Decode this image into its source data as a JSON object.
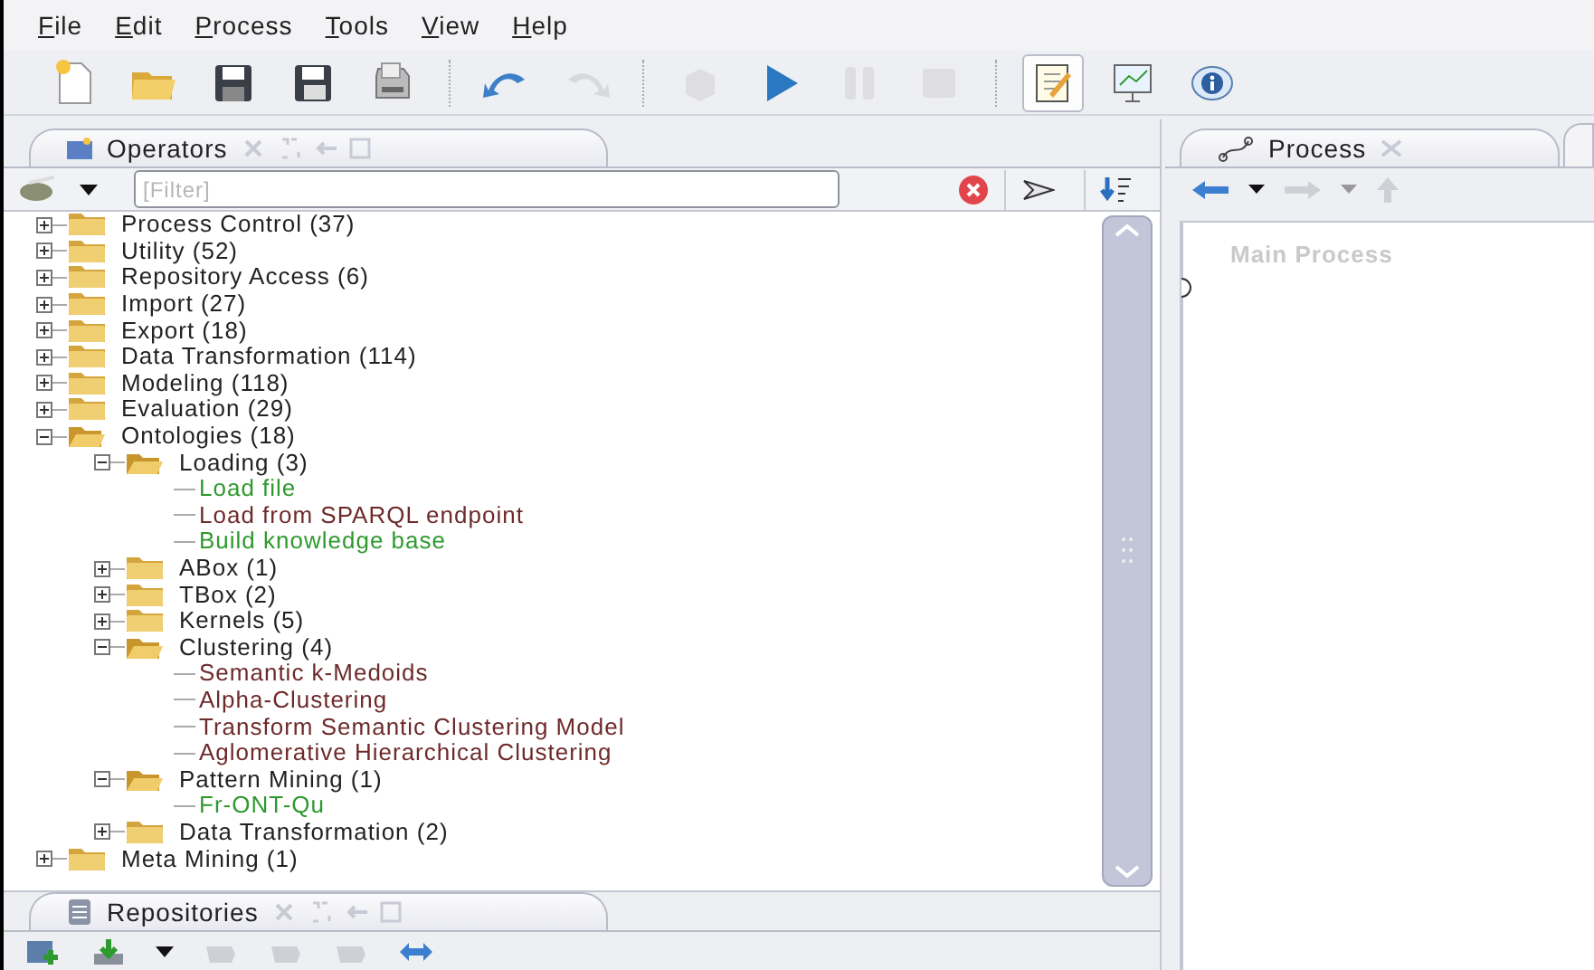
{
  "menu": [
    {
      "label": "File"
    },
    {
      "label": "Edit"
    },
    {
      "label": "Process"
    },
    {
      "label": "Tools"
    },
    {
      "label": "View"
    },
    {
      "label": "Help"
    }
  ],
  "toolbar": [
    [
      {
        "kind": "new",
        "disabled": false
      },
      {
        "kind": "open",
        "disabled": false
      },
      {
        "kind": "save",
        "disabled": false
      },
      {
        "kind": "saveas",
        "disabled": false
      },
      {
        "kind": "print",
        "disabled": false
      }
    ],
    [
      {
        "kind": "undo",
        "disabled": false
      },
      {
        "kind": "redo",
        "disabled": true
      }
    ],
    [
      {
        "kind": "cube",
        "disabled": true
      },
      {
        "kind": "run",
        "disabled": false
      },
      {
        "kind": "pause",
        "disabled": true
      },
      {
        "kind": "stop",
        "disabled": true
      }
    ],
    [
      {
        "kind": "design",
        "disabled": false,
        "selected": true
      },
      {
        "kind": "results",
        "disabled": false,
        "selected": false
      },
      {
        "kind": "info",
        "disabled": false,
        "selected": false
      }
    ]
  ],
  "operators_panel": {
    "tab": "Operators",
    "filter": {
      "placeholder": "[Filter]"
    },
    "tree": [
      {
        "label": "Process Control (37)",
        "expanded": false
      },
      {
        "label": "Utility (52)",
        "expanded": false
      },
      {
        "label": "Repository Access (6)",
        "expanded": false
      },
      {
        "label": "Import (27)",
        "expanded": false
      },
      {
        "label": "Export (18)",
        "expanded": false
      },
      {
        "label": "Data Transformation (114)",
        "expanded": false
      },
      {
        "label": "Modeling (118)",
        "expanded": false
      },
      {
        "label": "Evaluation (29)",
        "expanded": false
      },
      {
        "label": "Ontologies (18)",
        "expanded": true,
        "children": [
          {
            "label": "Loading (3)",
            "expanded": true,
            "children": [
              {
                "label": "Load file",
                "color": "#2e9a2e"
              },
              {
                "label": "Load from SPARQL endpoint",
                "color": "#6e2a2a"
              },
              {
                "label": "Build knowledge base",
                "color": "#2e9a2e"
              }
            ]
          },
          {
            "label": "ABox (1)",
            "expanded": false
          },
          {
            "label": "TBox (2)",
            "expanded": false
          },
          {
            "label": "Kernels (5)",
            "expanded": false
          },
          {
            "label": "Clustering (4)",
            "expanded": true,
            "children": [
              {
                "label": "Semantic k-Medoids",
                "color": "#6e2a2a"
              },
              {
                "label": "Alpha-Clustering",
                "color": "#6e2a2a"
              },
              {
                "label": "Transform Semantic Clustering Model",
                "color": "#6e2a2a"
              },
              {
                "label": "Aglomerative Hierarchical Clustering",
                "color": "#6e2a2a"
              }
            ]
          },
          {
            "label": "Pattern Mining (1)",
            "expanded": true,
            "children": [
              {
                "label": "Fr-ONT-Qu",
                "color": "#2e9a2e"
              }
            ]
          },
          {
            "label": "Data Transformation (2)",
            "expanded": false
          }
        ]
      },
      {
        "label": "Meta Mining (1)",
        "expanded": false
      }
    ]
  },
  "repositories_panel": {
    "tab": "Repositories"
  },
  "process_panel": {
    "tab": "Process",
    "canvas_title": "Main Process"
  }
}
